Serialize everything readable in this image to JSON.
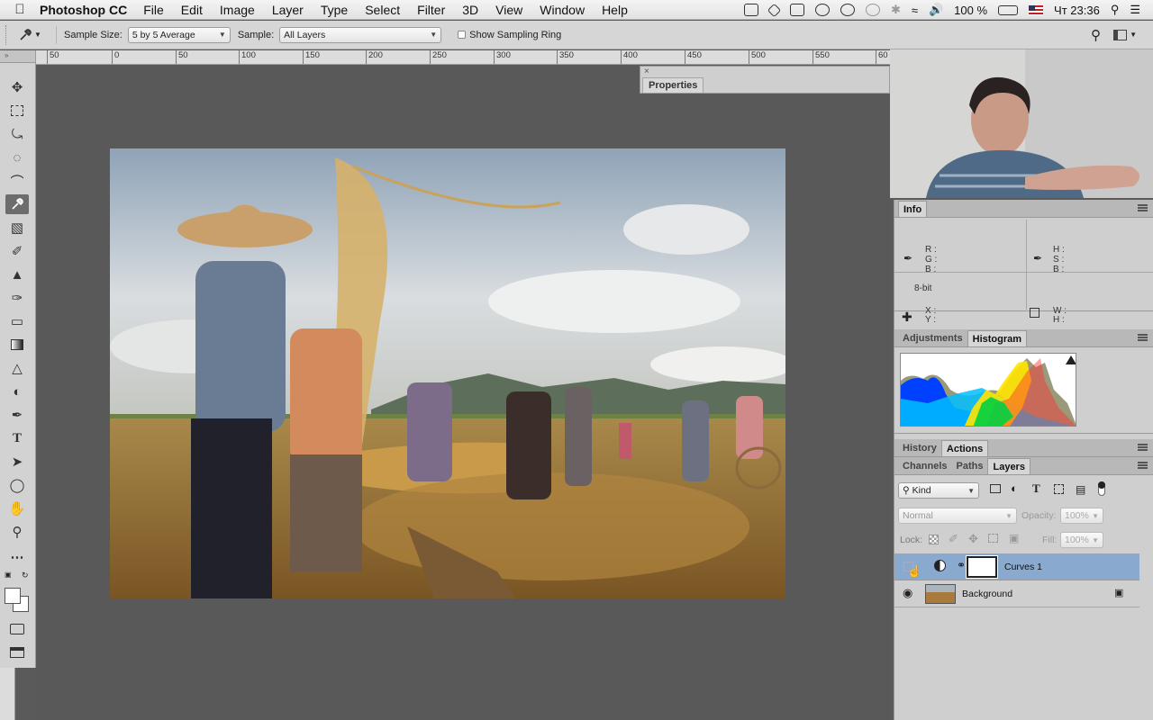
{
  "menubar": {
    "app": "Photoshop CC",
    "items": [
      "File",
      "Edit",
      "Image",
      "Layer",
      "Type",
      "Select",
      "Filter",
      "3D",
      "View",
      "Window",
      "Help"
    ],
    "battery": "100 %",
    "clock": "Чт 23:36"
  },
  "options": {
    "sample_size_label": "Sample Size:",
    "sample_size_value": "5 by 5 Average",
    "sample_label": "Sample:",
    "sample_value": "All Layers",
    "sampling_ring_label": "Show Sampling Ring"
  },
  "ruler": {
    "ticks": [
      "50",
      "0",
      "50",
      "100",
      "150",
      "200",
      "250",
      "300",
      "350",
      "400",
      "450",
      "500",
      "550",
      "60"
    ]
  },
  "properties": {
    "tab": "Properties"
  },
  "info": {
    "tab": "Info",
    "rgb": [
      "R :",
      "G :",
      "B :"
    ],
    "hsb": [
      "H :",
      "S :",
      "B :"
    ],
    "bit_depth": "8-bit",
    "xy": [
      "X :",
      "Y :"
    ],
    "wh": [
      "W :",
      "H :"
    ]
  },
  "adj_tabs": [
    "Adjustments",
    "Histogram"
  ],
  "hist_tabs": [
    "History",
    "Actions"
  ],
  "layer_tabs": [
    "Channels",
    "Paths",
    "Layers"
  ],
  "layers_panel": {
    "filter_kind": "Kind",
    "blend_mode": "Normal",
    "opacity_label": "Opacity:",
    "opacity_value": "100%",
    "lock_label": "Lock:",
    "fill_label": "Fill:",
    "fill_value": "100%",
    "layers": [
      {
        "name": "Curves 1",
        "visible": false,
        "selected": true
      },
      {
        "name": "Background",
        "visible": true,
        "selected": false
      }
    ]
  },
  "colors": {
    "selected_layer": "#8aa9cf",
    "panel_bg": "#cfcfcf",
    "canvas_bg": "#595959"
  }
}
